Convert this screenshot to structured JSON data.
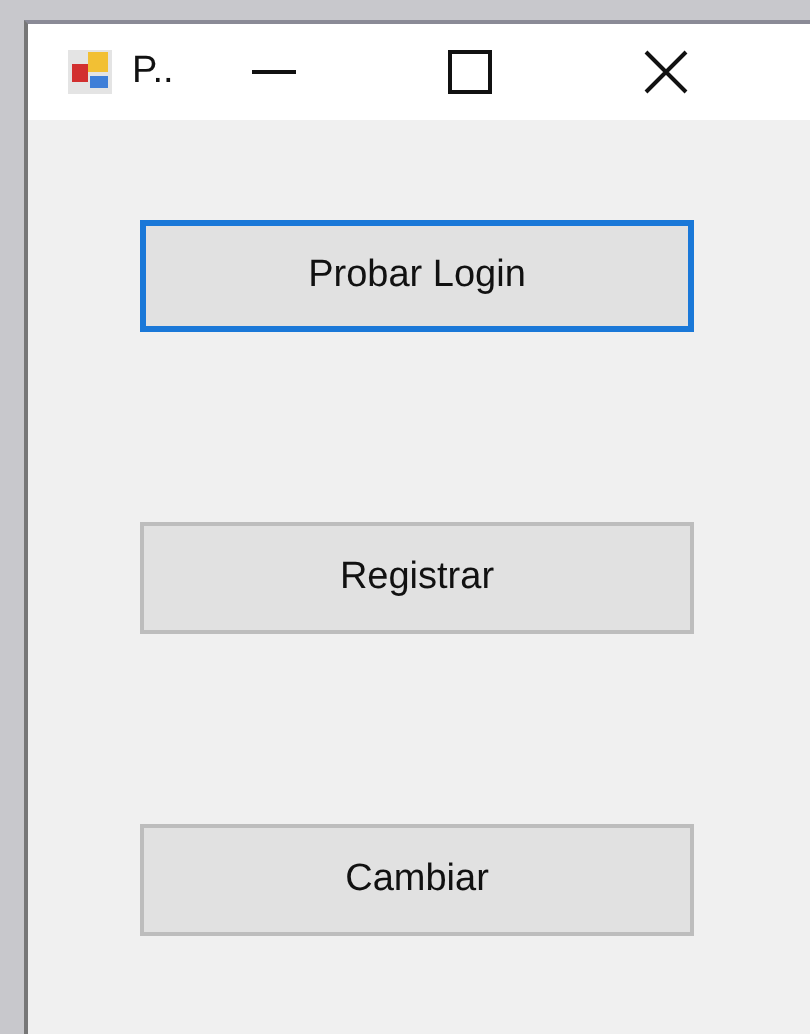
{
  "window": {
    "title": "P.."
  },
  "buttons": [
    {
      "label": "Probar Login",
      "focused": true
    },
    {
      "label": "Registrar",
      "focused": false
    },
    {
      "label": "Cambiar",
      "focused": false
    }
  ]
}
